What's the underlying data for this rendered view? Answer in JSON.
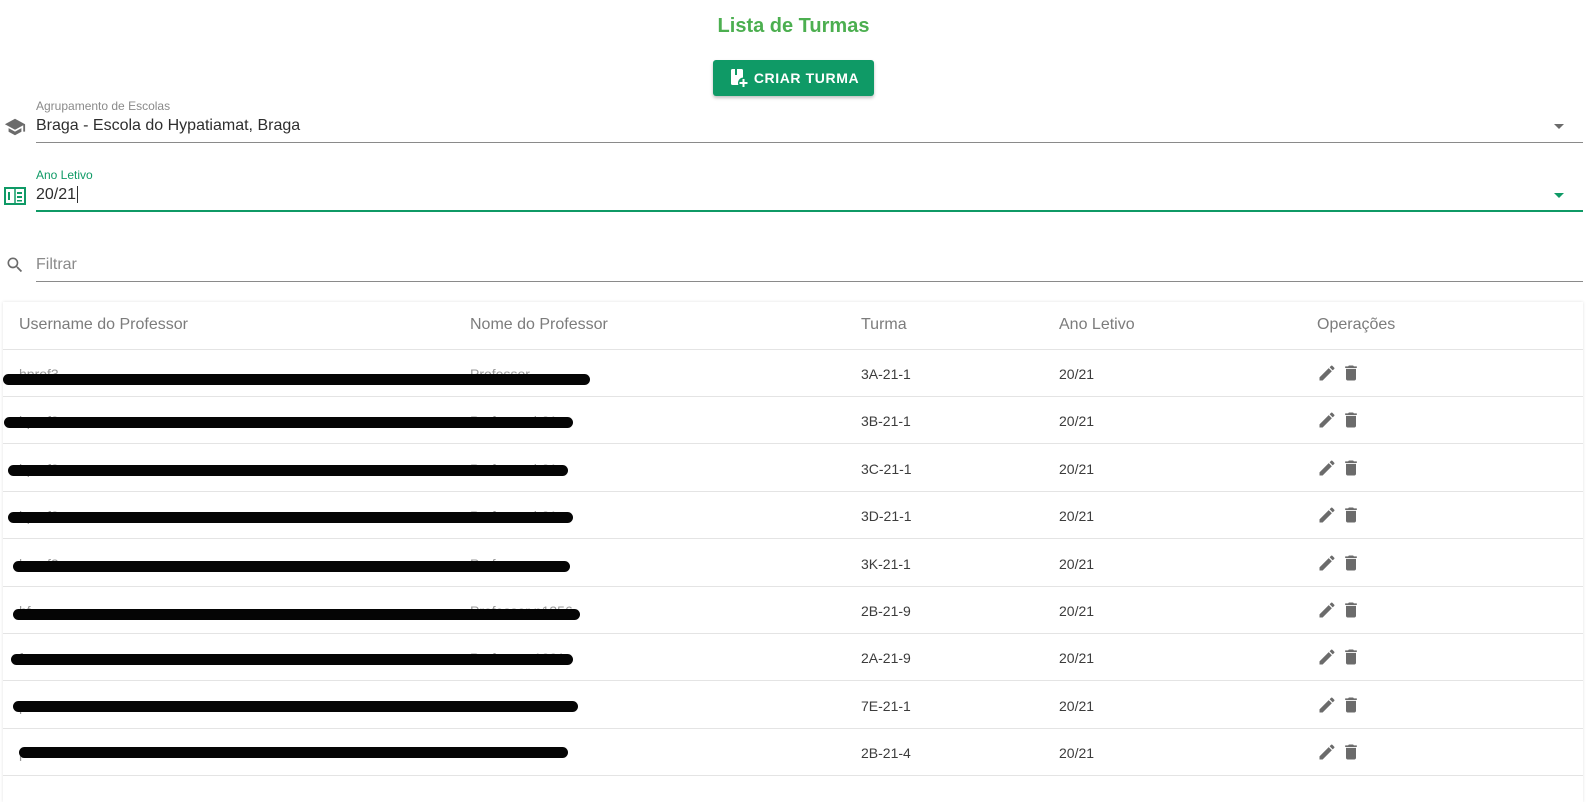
{
  "header": {
    "title": "Lista de Turmas",
    "create_button_label": "CRIAR TURMA",
    "create_button_icon": "add-class-icon"
  },
  "filters": {
    "school_group": {
      "label": "Agrupamento de Escolas",
      "value": "Braga - Escola do Hypatiamat, Braga",
      "icon": "school-icon"
    },
    "school_year": {
      "label": "Ano Letivo",
      "value": "20/21",
      "icon": "calendar-icon",
      "focused": true
    },
    "search": {
      "placeholder": "Filtrar",
      "value": "",
      "icon": "search-icon"
    }
  },
  "colors": {
    "title": "#4caf50",
    "primary": "#0f9a66",
    "icon_gray": "#6b6b6b"
  },
  "table": {
    "columns": [
      "Username do Professor",
      "Nome do Professor",
      "Turma",
      "Ano Letivo",
      "Operações"
    ],
    "rows": [
      {
        "username": "hprof3",
        "name": "Professor",
        "turma": "3A-21-1",
        "ano": "20/21"
      },
      {
        "username": "hprof3",
        "name": "Professor h21",
        "turma": "3B-21-1",
        "ano": "20/21"
      },
      {
        "username": "hprof2",
        "name": "Professor h21",
        "turma": "3C-21-1",
        "ano": "20/21"
      },
      {
        "username": "hprof2",
        "name": "Professor h21",
        "turma": "3D-21-1",
        "ano": "20/21"
      },
      {
        "username": "hprof2",
        "name": "Professor",
        "turma": "3K-21-1",
        "ano": "20/21"
      },
      {
        "username": "hf",
        "name": "Professor p1356",
        "turma": "2B-21-9",
        "ano": "20/21"
      },
      {
        "username": "formacao",
        "name": "Professor 1001",
        "turma": "2A-21-9",
        "ano": "20/21"
      },
      {
        "username": "prof",
        "name": "Professor h131",
        "turma": "7E-21-1",
        "ano": "20/21"
      },
      {
        "username": "prof",
        "name": "Professor h20",
        "turma": "2B-21-4",
        "ano": "20/21"
      }
    ],
    "operations": {
      "edit_icon": "pencil-icon",
      "delete_icon": "trash-icon"
    }
  }
}
